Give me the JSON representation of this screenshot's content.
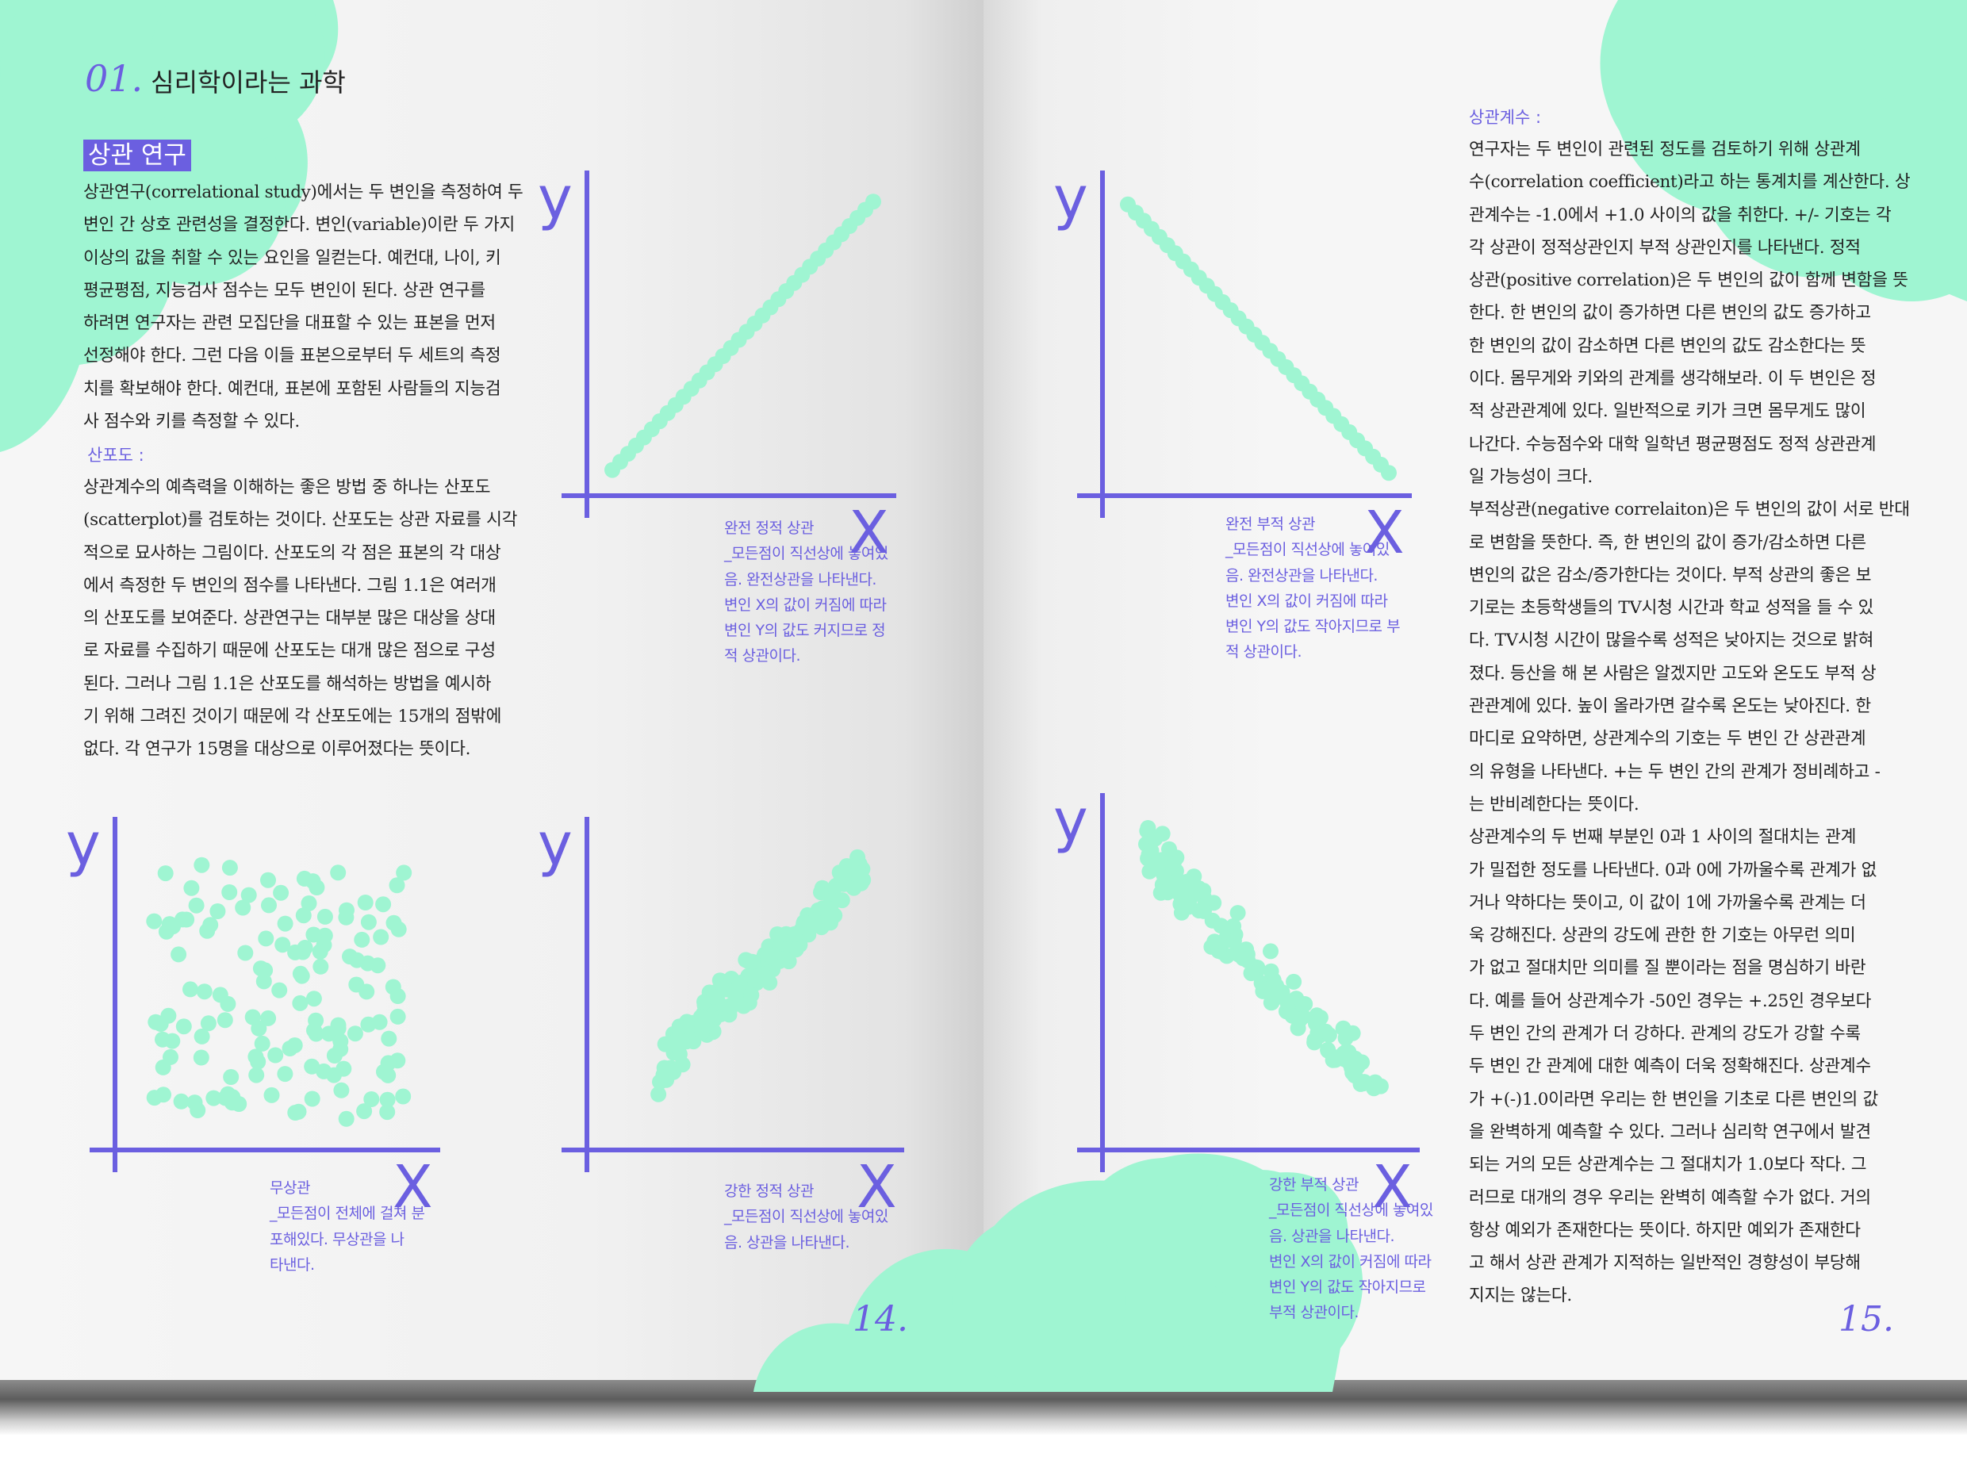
{
  "left_page": {
    "chapter_number": "01.",
    "chapter_title": "심리학이라는 과학",
    "section_title": "상관 연구",
    "intro_lines": [
      "상관연구(correlational study)에서는 두 변인을 측정하여 두",
      "변인 간 상호 관련성을 결정한다. 변인(variable)이란 두 가지",
      "이상의 값을 취할 수 있는 요인을 일컫는다. 예컨대, 나이, 키",
      "평균평점, 지능검사 점수는 모두 변인이 된다. 상관 연구를",
      "하려면 연구자는 관련 모집단을 대표할 수 있는 표본을 먼저",
      "선정해야 한다. 그런 다음 이들 표본으로부터 두 세트의 측정",
      "치를 확보해야 한다. 예컨대, 표본에 포함된 사람들의 지능검",
      "사 점수와 키를 측정할 수 있다."
    ],
    "scatter_heading": "산포도 :",
    "scatter_lines": [
      " 상관계수의 예측력을 이해하는 좋은 방법 중 하나는 산포도",
      "(scatterplot)를 검토하는 것이다. 산포도는 상관 자료를 시각",
      "적으로 묘사하는 그림이다. 산포도의 각 점은 표본의 각 대상",
      "에서 측정한 두 변인의 점수를 나타낸다. 그림 1.1은 여러개",
      "의 산포도를 보여준다. 상관연구는 대부분 많은 대상을 상대",
      "로 자료를 수집하기 때문에 산포도는 대개 많은 점으로 구성",
      "된다. 그러나 그림 1.1은 산포도를 해석하는 방법을 예시하",
      "기 위해 그려진 것이기 때문에 각 산포도에는 15개의 점밖에",
      "없다. 각 연구가 15명을 대상으로 이루어졌다는 뜻이다."
    ],
    "page_number": "14."
  },
  "right_page": {
    "heading": "상관계수 :",
    "body_lines": [
      "  연구자는 두 변인이 관련된 정도를 검토하기 위해 상관계",
      "수(correlation coefficient)라고 하는 통계치를 계산한다. 상",
      "관계수는 -1.0에서 +1.0 사이의 값을 취한다. +/- 기호는 각",
      "각 상관이 정적상관인지 부적 상관인지를 나타낸다. 정적",
      "상관(positive correlation)은 두 변인의 값이 함께 변함을 뜻",
      "한다. 한 변인의 값이 증가하면 다른 변인의 값도 증가하고",
      "한 변인의 값이 감소하면 다른 변인의 값도 감소한다는 뜻",
      "이다. 몸무게와 키와의 관계를 생각해보라. 이 두 변인은 정",
      "적 상관관계에 있다. 일반적으로 키가 크면 몸무게도 많이",
      "나간다. 수능점수와 대학 일학년 평균평점도 정적 상관관계",
      "일 가능성이 크다.",
      " 부적상관(negative correlaiton)은 두 변인의 값이 서로 반대",
      "로 변함을 뜻한다. 즉, 한 변인의 값이 증가/감소하면 다른",
      "변인의 값은 감소/증가한다는 것이다. 부적 상관의 좋은 보",
      "기로는 초등학생들의 TV시청 시간과 학교 성적을 들 수 있",
      "다. TV시청 시간이 많을수록 성적은 낮아지는 것으로 밝혀",
      "졌다. 등산을 해 본 사람은 알겠지만 고도와 온도도 부적 상",
      "관관계에 있다. 높이 올라가면 갈수록 온도는 낮아진다. 한",
      "마디로 요약하면, 상관계수의 기호는 두 변인 간 상관관계",
      "의 유형을 나타낸다. +는 두 변인 간의 관계가 정비례하고 -",
      "는 반비례한다는 뜻이다.",
      " 상관계수의 두 번째 부분인 0과 1 사이의 절대치는 관계",
      "가 밀접한 정도를 나타낸다. 0과 0에 가까울수록 관계가 없",
      "거나 약하다는 뜻이고, 이 값이 1에 가까울수록 관계는 더",
      "욱 강해진다. 상관의 강도에 관한 한 기호는 아무런 의미",
      "가 없고 절대치만 의미를 질 뿐이라는 점을 명심하기 바란",
      "다. 예를 들어 상관계수가 -50인 경우는 +.25인 경우보다",
      "두 변인 간의 관계가 더 강하다. 관계의 강도가 강할 수록",
      "두 변인 간 관계에 대한 예측이 더욱 정확해진다. 상관계수",
      "가 +(-)1.0이라면 우리는 한 변인을 기초로 다른 변인의 값",
      "을 완벽하게 예측할 수 있다. 그러나 심리학 연구에서 발견",
      "되는 거의 모든 상관계수는 그 절대치가 1.0보다 작다. 그",
      "러므로 대개의 경우 우리는 완벽히 예측할 수가 없다. 거의",
      "항상 예외가 존재한다는 뜻이다. 하지만 예외가 존재한다",
      "고 해서 상관 관계가 지적하는 일반적인 경향성이 부당해",
      "지지는 않는다."
    ],
    "page_number": "15."
  },
  "axis_labels": {
    "x": "X",
    "y": "y"
  },
  "captions": {
    "perfect_positive": [
      "완전 정적 상관",
      "_모든점이 직선상에 놓여있",
      "음. 완전상관을 나타낸다.",
      "변인 X의 값이 커짐에 따라",
      "변인 Y의 값도 커지므로 정",
      "적 상관이다."
    ],
    "perfect_negative": [
      "완전 부적 상관",
      "_모든점이 직선상에 놓여있",
      "음. 완전상관을 나타낸다.",
      "변인 X의 값이 커짐에 따라",
      "변인 Y의 값도 작아지므로 부",
      "적 상관이다."
    ],
    "no_correlation": [
      "무상관",
      "_모든점이 전체에 걸쳐 분",
      "포해있다. 무상관을 나",
      "타낸다."
    ],
    "strong_positive": [
      "강한 정적 상관",
      "_모든점이 직선상에 놓여있",
      "음. 상관을 나타낸다."
    ],
    "strong_negative": [
      "강한 부적 상관",
      "_모든점이 직선상에 놓여있",
      "음. 상관을 나타낸다.",
      "변인 X의 값이 커짐에 따라",
      "변인 Y의 값도 작아지므로",
      "부적 상관이다."
    ]
  },
  "chart_data": [
    {
      "type": "scatter",
      "title": "",
      "xlabel": "X",
      "ylabel": "y",
      "xlim": [
        0,
        1
      ],
      "ylim": [
        0,
        1
      ],
      "pattern": "perfect-positive",
      "seed": 3,
      "point_count": 34,
      "x": [
        0.05,
        0.08,
        0.14,
        0.16,
        0.26,
        0.28,
        0.36,
        0.38,
        0.46,
        0.49,
        0.56,
        0.59,
        0.66,
        0.69,
        0.78,
        0.81,
        0.86,
        0.89,
        0.96,
        0.98
      ],
      "y": [
        0.05,
        0.08,
        0.14,
        0.16,
        0.26,
        0.28,
        0.36,
        0.38,
        0.46,
        0.49,
        0.56,
        0.59,
        0.66,
        0.69,
        0.78,
        0.81,
        0.86,
        0.89,
        0.96,
        0.98
      ]
    },
    {
      "type": "scatter",
      "title": "",
      "xlabel": "X",
      "ylabel": "y",
      "xlim": [
        0,
        1
      ],
      "ylim": [
        0,
        1
      ],
      "pattern": "perfect-negative",
      "seed": 7,
      "point_count": 34,
      "x": [
        0.05,
        0.09,
        0.15,
        0.18,
        0.26,
        0.29,
        0.36,
        0.39,
        0.47,
        0.5,
        0.58,
        0.61,
        0.68,
        0.72,
        0.8,
        0.83,
        0.9,
        0.93,
        0.98
      ],
      "y": [
        0.97,
        0.93,
        0.87,
        0.84,
        0.76,
        0.73,
        0.66,
        0.62,
        0.54,
        0.51,
        0.43,
        0.4,
        0.33,
        0.29,
        0.21,
        0.18,
        0.12,
        0.08,
        0.04
      ]
    },
    {
      "type": "scatter",
      "title": "",
      "xlabel": "X",
      "ylabel": "y",
      "xlim": [
        0,
        1
      ],
      "ylim": [
        0,
        1
      ],
      "pattern": "none",
      "seed": 11,
      "point_count": 140
    },
    {
      "type": "scatter",
      "title": "",
      "xlabel": "X",
      "ylabel": "y",
      "xlim": [
        0,
        1
      ],
      "ylim": [
        0,
        1
      ],
      "pattern": "strong-positive",
      "seed": 19,
      "point_count": 170
    },
    {
      "type": "scatter",
      "title": "",
      "xlabel": "X",
      "ylabel": "y",
      "xlim": [
        0,
        1
      ],
      "ylim": [
        0,
        1
      ],
      "pattern": "strong-negative",
      "seed": 23,
      "point_count": 150
    }
  ],
  "colors": {
    "accent": "#6b5fe0",
    "mint": "#9ff5d2",
    "text": "#222222"
  }
}
